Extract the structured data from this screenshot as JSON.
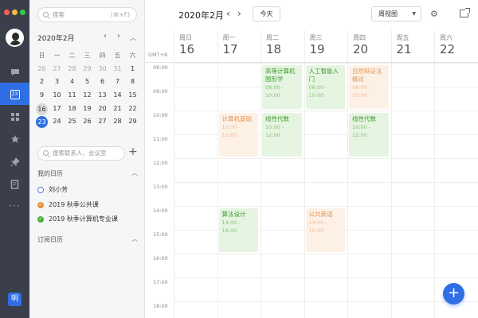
{
  "window": {
    "controls": [
      {
        "color": "#fc605b"
      },
      {
        "color": "#fdbc40"
      },
      {
        "color": "#34c84a"
      }
    ]
  },
  "rail": {
    "me_badge": "明"
  },
  "sidebar": {
    "search": {
      "placeholder": "搜索",
      "shortcut": "(⌘+F)"
    },
    "mini_calendar": {
      "title": "2020年2月",
      "weekdays": [
        "日",
        "一",
        "二",
        "三",
        "四",
        "五",
        "六"
      ],
      "weeks": [
        [
          "26",
          "27",
          "28",
          "29",
          "30",
          "31",
          "1"
        ],
        [
          "2",
          "3",
          "4",
          "5",
          "6",
          "7",
          "8"
        ],
        [
          "9",
          "10",
          "11",
          "12",
          "13",
          "14",
          "15"
        ],
        [
          "16",
          "17",
          "18",
          "19",
          "20",
          "21",
          "22"
        ],
        [
          "23",
          "24",
          "25",
          "26",
          "27",
          "28",
          "29"
        ]
      ],
      "today": "16",
      "selected": "23"
    },
    "contact_search": {
      "placeholder": "搜索联系人、会议室"
    },
    "my_calendars": {
      "title": "我的日历",
      "items": [
        {
          "label": "刘小芳",
          "color": "#4a7be0"
        },
        {
          "label": "2019 秋季公共课",
          "color": "#e8913f"
        },
        {
          "label": "2019 秋季计算机专业课",
          "color": "#4caf3c"
        }
      ]
    },
    "subscribed": {
      "title": "订阅日历"
    }
  },
  "header": {
    "title": "2020年2月",
    "today_label": "今天",
    "view_label": "周视图"
  },
  "week": {
    "timezone": "GMT+8",
    "days": [
      {
        "weekday": "周日",
        "date": "16"
      },
      {
        "weekday": "周一",
        "date": "17"
      },
      {
        "weekday": "周二",
        "date": "18"
      },
      {
        "weekday": "周三",
        "date": "19"
      },
      {
        "weekday": "周四",
        "date": "20"
      },
      {
        "weekday": "周五",
        "date": "21"
      },
      {
        "weekday": "周六",
        "date": "22"
      }
    ],
    "hours": [
      "08:00",
      "09:00",
      "10:00",
      "11:00",
      "12:00",
      "13:00",
      "14:00",
      "15:00",
      "16:00",
      "17:00",
      "18:00"
    ]
  },
  "events": [
    {
      "title": "高等计算机图形学",
      "time": "08:00 - 10:00",
      "day": "周二",
      "color": "green"
    },
    {
      "title": "人工智能入门",
      "time": "08:00 - 10:00",
      "day": "周三",
      "color": "green"
    },
    {
      "title": "自然辩证法概论",
      "time": "08:00 - 10:00",
      "day": "周四",
      "color": "orange"
    },
    {
      "title": "计算机基础",
      "time": "10:00 - 12:00",
      "day": "周一",
      "color": "orange"
    },
    {
      "title": "线性代数",
      "time": "10:00 - 12:00",
      "day": "周二",
      "color": "green"
    },
    {
      "title": "线性代数",
      "time": "10:00 - 12:00",
      "day": "周四",
      "color": "green"
    },
    {
      "title": "算法设计",
      "time": "14:00 - 16:00",
      "day": "周一",
      "color": "green"
    },
    {
      "title": "公共英语",
      "time": "14:00 - 16:00",
      "day": "周三",
      "color": "orange"
    }
  ],
  "colors": {
    "accent": "#2f6fe3",
    "rail": "#3a3f4b",
    "event_green": "#e6f5e2",
    "event_orange": "#fdf1e6"
  }
}
